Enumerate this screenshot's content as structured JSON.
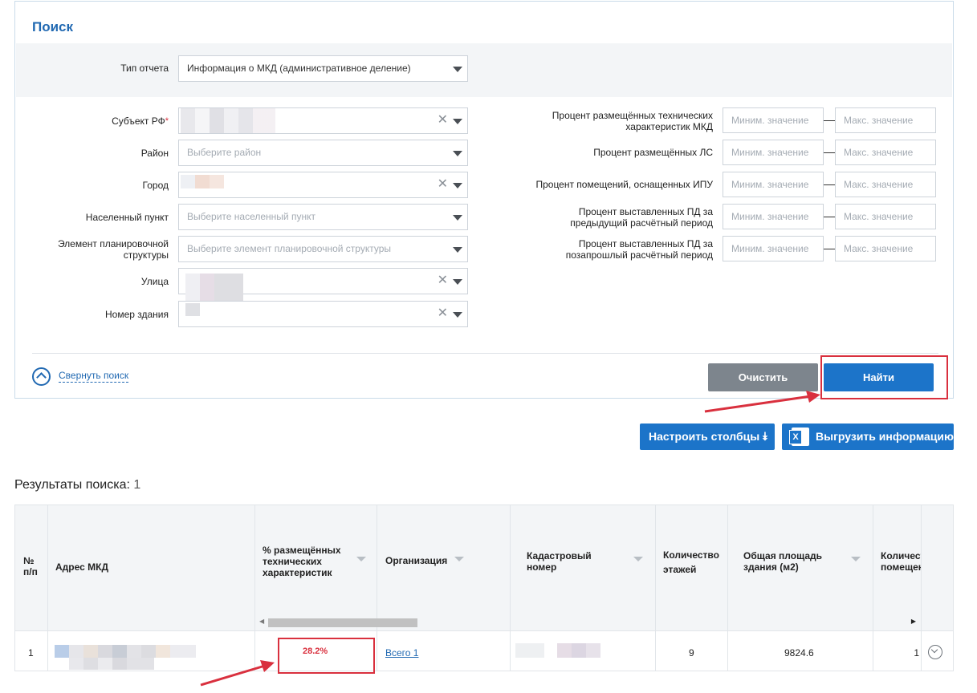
{
  "search": {
    "title": "Поиск",
    "report_type": {
      "label": "Тип отчета",
      "value": "Информация о МКД (административное деление)"
    },
    "left_fields": {
      "subject": {
        "label": "Субъект РФ",
        "required_mark": "*"
      },
      "district": {
        "label": "Район",
        "placeholder": "Выберите район"
      },
      "city": {
        "label": "Город"
      },
      "settlement": {
        "label": "Населенный пункт",
        "placeholder": "Выберите населенный пункт"
      },
      "planning": {
        "label_line1": "Элемент планировочной",
        "label_line2": "структуры",
        "placeholder": "Выберите элемент планировочной структуры"
      },
      "street": {
        "label": "Улица"
      },
      "building": {
        "label": "Номер здания"
      }
    },
    "right_fields": [
      {
        "label_line1": "Процент размещённых технических",
        "label_line2": "характеристик МКД",
        "min_placeholder": "Миним. значение",
        "max_placeholder": "Макс. значение"
      },
      {
        "label_line1": "Процент размещённых ЛС",
        "label_line2": "",
        "min_placeholder": "Миним. значение",
        "max_placeholder": "Макс. значение"
      },
      {
        "label_line1": "Процент помещений, оснащенных ИПУ",
        "label_line2": "",
        "min_placeholder": "Миним. значение",
        "max_placeholder": "Макс. значение"
      },
      {
        "label_line1": "Процент выставленных ПД за",
        "label_line2": "предыдущий расчётный период",
        "min_placeholder": "Миним. значение",
        "max_placeholder": "Макс. значение"
      },
      {
        "label_line1": "Процент выставленных ПД за",
        "label_line2": "позапрошлый расчётный период",
        "min_placeholder": "Миним. значение",
        "max_placeholder": "Макс. значение"
      }
    ],
    "collapse_label": "Свернуть поиск",
    "clear_label": "Очистить",
    "find_label": "Найти"
  },
  "actions": {
    "columns_label": "Настроить столбцы",
    "export_label": "Выгрузить информацию"
  },
  "results": {
    "title": "Результаты поиска:",
    "count": "1",
    "columns": [
      {
        "line1": "№",
        "line2": "п/п"
      },
      {
        "line1": "Адрес МКД",
        "line2": ""
      },
      {
        "line1": "% размещённых",
        "line2": "технических",
        "line3": "характеристик"
      },
      {
        "line1": "Организация",
        "line2": ""
      },
      {
        "line1": "Кадастровый",
        "line2": "номер"
      },
      {
        "line1": "Количество",
        "line2": "этажей"
      },
      {
        "line1": "Общая площадь",
        "line2": "здания (м2)"
      },
      {
        "line1": "Количест",
        "line2": "помещен"
      }
    ],
    "row": {
      "num": "1",
      "percent": "28.2%",
      "organization": "Всего 1",
      "floors": "9",
      "area": "9824.6",
      "rooms": "1"
    }
  },
  "colors": {
    "primary": "#1c74c9",
    "title": "#2169b2",
    "highlight": "#d9303e",
    "clear_button": "#7d858d"
  }
}
